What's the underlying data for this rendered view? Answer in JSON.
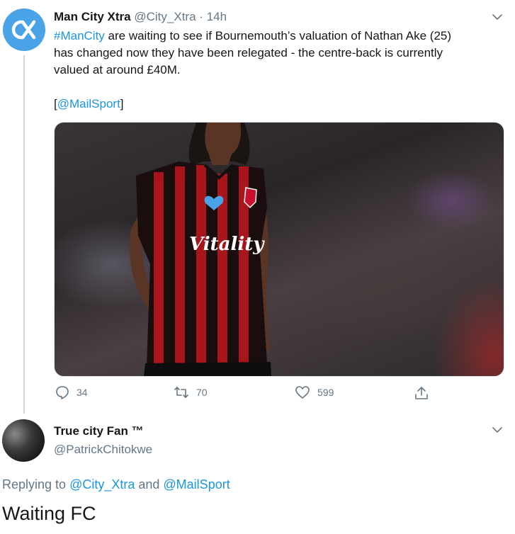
{
  "tweet": {
    "author_name": "Man City Xtra",
    "handle": "@City_Xtra",
    "separator": "·",
    "time": "14h",
    "text_hashtag": "#ManCity",
    "text_line1_rest": " are waiting to see if Bournemouth’s valuation of Nathan Ake (25)",
    "text_line2": "has changed now they have been relegated - the centre-back is currently",
    "text_line3": "valued at around £40M.",
    "source_open": "[",
    "source_mention": "@MailSport",
    "source_close": "]",
    "replies": "34",
    "retweets": "70",
    "likes": "599"
  },
  "reply": {
    "author_name": "True city Fan ™",
    "handle": "@PatrickChitokwe",
    "replying_prefix": "Replying to ",
    "replying_mention1": "@City_Xtra",
    "replying_and": " and ",
    "replying_mention2": "@MailSport",
    "text": "Waiting FC"
  },
  "colors": {
    "link": "#1b95e0",
    "muted": "#657786",
    "brand_avatar": "#4aa3e6"
  },
  "icons": [
    "city-xtra-logo-icon",
    "chevron-down-icon",
    "reply-icon",
    "retweet-icon",
    "like-icon",
    "share-icon"
  ]
}
